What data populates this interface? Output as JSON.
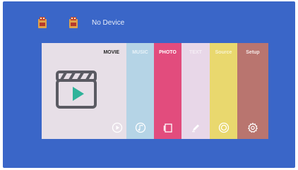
{
  "header": {
    "device_label": "No Device",
    "icons": [
      "usb-drive-icon",
      "usb-drive-icon"
    ]
  },
  "menu": {
    "items": [
      {
        "label": "MOVIE",
        "icon": "play-circle-icon",
        "color": "#e7dfe7"
      },
      {
        "label": "MUSIC",
        "icon": "music-note-icon",
        "color": "#b5d4e6"
      },
      {
        "label": "PHOTO",
        "icon": "photo-icon",
        "color": "#e24c7d"
      },
      {
        "label": "TEXT",
        "icon": "pen-icon",
        "color": "#e8d7e8"
      },
      {
        "label": "Source",
        "icon": "source-icon",
        "color": "#e9d86e"
      },
      {
        "label": "Setup",
        "icon": "gear-icon",
        "color": "#b9756f"
      }
    ],
    "featured_icon": "clapperboard-play-icon"
  },
  "colors": {
    "background": "#3a66c8",
    "accent": "#2fb39a"
  }
}
